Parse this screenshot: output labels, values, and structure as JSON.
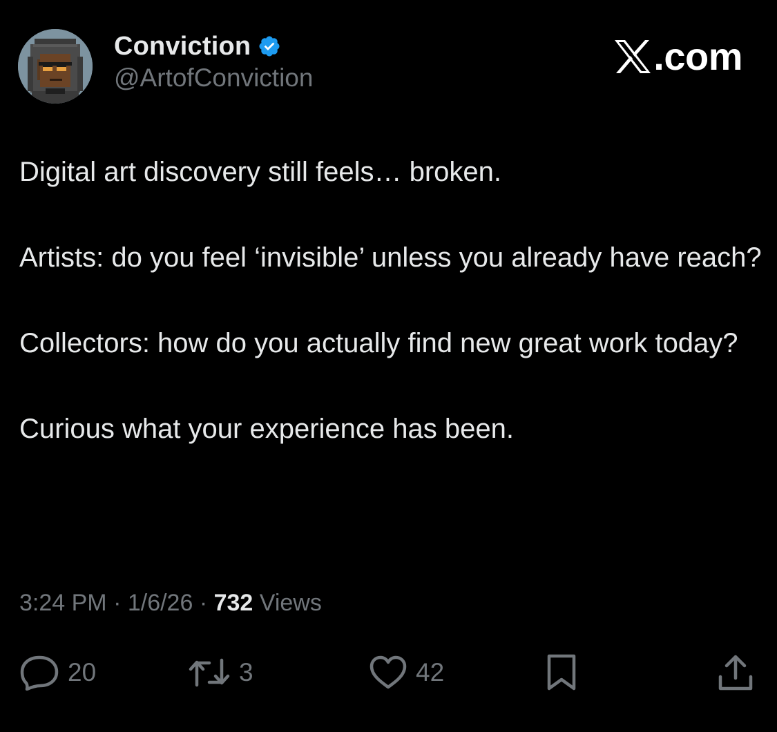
{
  "author": {
    "display_name": "Conviction",
    "handle": "@ArtofConviction",
    "verified_icon": "verified-badge-icon",
    "avatar_icon": "pixel-art-hooded-figure-avatar"
  },
  "brand": {
    "logo_icon": "x-logo-icon",
    "text": ".com"
  },
  "tweet": {
    "paragraphs": [
      "Digital art discovery still feels… broken.",
      "Artists: do you feel ‘invisible’ unless you already have reach?",
      "Collectors: how do you actually find new great work today?",
      "Curious what your experience has been."
    ]
  },
  "meta": {
    "time": "3:24 PM",
    "separator": " · ",
    "date": "1/6/26",
    "views_count": "732",
    "views_label": " Views"
  },
  "actions": {
    "replies": "20",
    "reposts": "3",
    "likes": "42"
  },
  "colors": {
    "background": "#000000",
    "primary_text": "#e7e9ea",
    "secondary_text": "#71767b",
    "verified_blue": "#1d9bf0"
  }
}
